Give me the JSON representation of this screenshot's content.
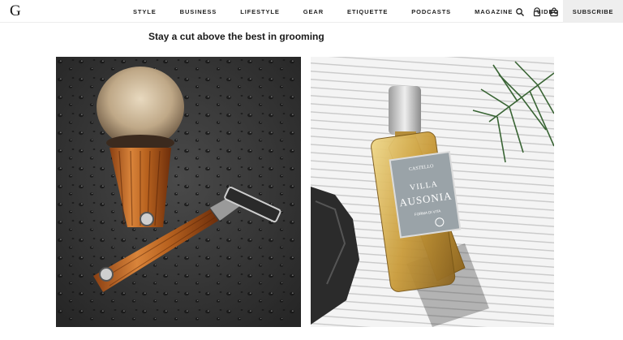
{
  "header": {
    "logo": "G",
    "nav": [
      "STYLE",
      "BUSINESS",
      "LIFESTYLE",
      "GEAR",
      "ETIQUETTE",
      "PODCASTS",
      "MAGAZINE",
      "VIDEO"
    ],
    "icons": [
      "search-icon",
      "account-icon",
      "bag-icon"
    ],
    "subscribe_label": "SUBSCRIBE"
  },
  "article": {
    "headline": "Stay a cut above the best in grooming"
  },
  "images": {
    "left": {
      "subject": "shaving-brush-and-razor"
    },
    "right": {
      "subject": "cologne-bottle",
      "label_brand": "CASTELLO",
      "label_line1": "VILLA",
      "label_line2": "AUSONIA",
      "label_sub": "FORMA DI VITA"
    }
  },
  "colors": {
    "subscribe_bg": "#eeeeee",
    "text": "#111111"
  }
}
